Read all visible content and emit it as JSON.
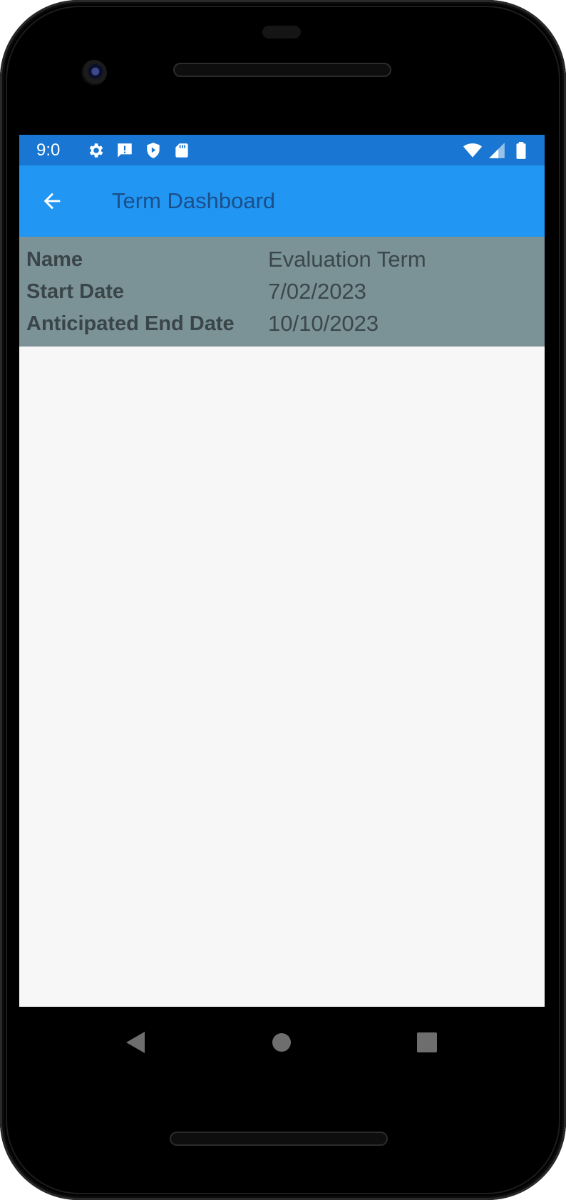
{
  "status_bar": {
    "time": "9:0",
    "icons_left": [
      "gear-icon",
      "alert-message-icon",
      "shield-play-icon",
      "sd-card-icon"
    ],
    "icons_right": [
      "wifi-icon",
      "cell-signal-icon",
      "battery-icon"
    ]
  },
  "app_bar": {
    "back_icon": "arrow-left-icon",
    "title": "Term Dashboard"
  },
  "term_info": [
    {
      "label": "Name",
      "value": "Evaluation Term"
    },
    {
      "label": "Start Date",
      "value": "7/02/2023"
    },
    {
      "label": "Anticipated End Date",
      "value": "10/10/2023"
    }
  ],
  "nav_bar": {
    "buttons": [
      "back-triangle-icon",
      "home-circle-icon",
      "recents-square-icon"
    ]
  },
  "colors": {
    "status_bar": "#1976d2",
    "app_bar": "#2196f3",
    "info_panel": "#7b9297",
    "screen_bg": "#f7f7f7"
  }
}
